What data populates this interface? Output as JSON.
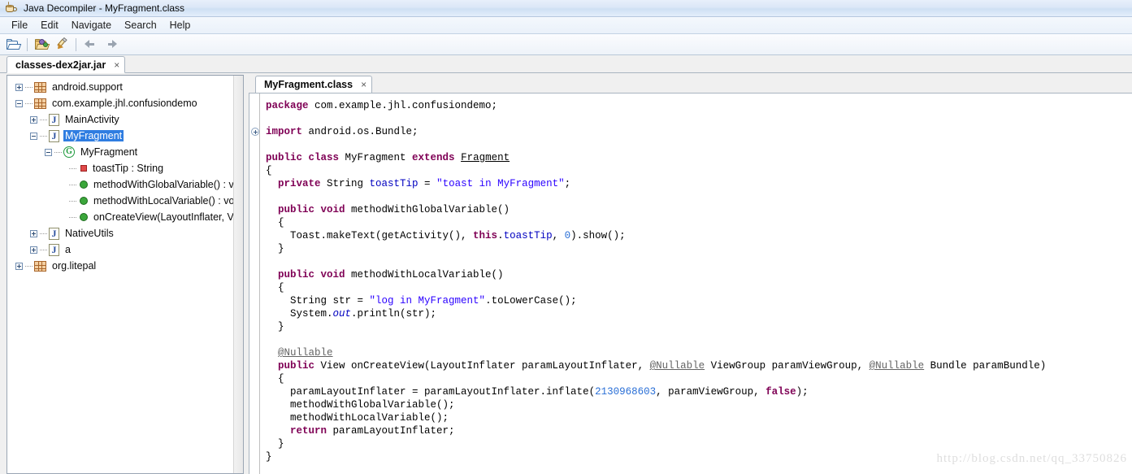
{
  "window": {
    "title": "Java Decompiler - MyFragment.class",
    "icon": "coffee-cup-icon"
  },
  "menubar": {
    "items": [
      {
        "label": "File"
      },
      {
        "label": "Edit"
      },
      {
        "label": "Navigate"
      },
      {
        "label": "Search"
      },
      {
        "label": "Help"
      }
    ]
  },
  "toolbar": {
    "buttons": [
      {
        "name": "open-file-button",
        "icon": "folder-open-icon"
      },
      {
        "name": "open-type-button",
        "icon": "folder-open-colored-icon"
      },
      {
        "name": "decompile-button",
        "icon": "pencil-icon"
      },
      {
        "name": "back-button",
        "icon": "arrow-left-icon"
      },
      {
        "name": "forward-button",
        "icon": "arrow-right-icon"
      }
    ]
  },
  "jar_tab": {
    "label": "classes-dex2jar.jar",
    "close": "×"
  },
  "tree": [
    {
      "depth": 0,
      "expander": "plus",
      "icon": "package-icon",
      "label": "android.support",
      "selected": false
    },
    {
      "depth": 0,
      "expander": "minus",
      "icon": "package-icon",
      "label": "com.example.jhl.confusiondemo",
      "selected": false
    },
    {
      "depth": 1,
      "expander": "plus",
      "icon": "class-file-icon",
      "label": "MainActivity",
      "selected": false
    },
    {
      "depth": 1,
      "expander": "minus",
      "icon": "class-file-icon",
      "label": "MyFragment",
      "selected": true
    },
    {
      "depth": 2,
      "expander": "minus",
      "icon": "class-green-icon",
      "label": "MyFragment",
      "selected": false
    },
    {
      "depth": 3,
      "expander": "none",
      "icon": "field-icon",
      "label": "toastTip : String",
      "selected": false
    },
    {
      "depth": 3,
      "expander": "none",
      "icon": "method-icon",
      "label": "methodWithGlobalVariable() : void",
      "selected": false
    },
    {
      "depth": 3,
      "expander": "none",
      "icon": "method-icon",
      "label": "methodWithLocalVariable() : void",
      "selected": false
    },
    {
      "depth": 3,
      "expander": "none",
      "icon": "method-icon",
      "label": "onCreateView(LayoutInflater, View",
      "selected": false
    },
    {
      "depth": 1,
      "expander": "plus",
      "icon": "class-file-icon",
      "label": "NativeUtils",
      "selected": false
    },
    {
      "depth": 1,
      "expander": "plus",
      "icon": "class-file-icon",
      "label": "a",
      "selected": false
    },
    {
      "depth": 0,
      "expander": "plus",
      "icon": "package-icon",
      "label": "org.litepal",
      "selected": false
    }
  ],
  "editor_tab": {
    "label": "MyFragment.class",
    "close": "×"
  },
  "code": {
    "lines": [
      [
        {
          "t": "package ",
          "c": "kw"
        },
        {
          "t": "com.example.jhl.confusiondemo;",
          "c": ""
        }
      ],
      [],
      [
        {
          "t": "import ",
          "c": "kw"
        },
        {
          "t": "android.os.Bundle;",
          "c": ""
        }
      ],
      [],
      [
        {
          "t": "public class ",
          "c": "kw"
        },
        {
          "t": "MyFragment ",
          "c": ""
        },
        {
          "t": "extends ",
          "c": "kw"
        },
        {
          "t": "Fragment",
          "c": "lnk"
        }
      ],
      [
        {
          "t": "{",
          "c": ""
        }
      ],
      [
        {
          "t": "  private ",
          "c": "kw"
        },
        {
          "t": "String ",
          "c": ""
        },
        {
          "t": "toastTip",
          "c": "fld"
        },
        {
          "t": " = ",
          "c": ""
        },
        {
          "t": "\"toast in MyFragment\"",
          "c": "str"
        },
        {
          "t": ";",
          "c": ""
        }
      ],
      [],
      [
        {
          "t": "  public void ",
          "c": "kw"
        },
        {
          "t": "methodWithGlobalVariable()",
          "c": ""
        }
      ],
      [
        {
          "t": "  {",
          "c": ""
        }
      ],
      [
        {
          "t": "    Toast.makeText(getActivity(), ",
          "c": ""
        },
        {
          "t": "this",
          "c": "kw"
        },
        {
          "t": ".",
          "c": ""
        },
        {
          "t": "toastTip",
          "c": "fld"
        },
        {
          "t": ", ",
          "c": ""
        },
        {
          "t": "0",
          "c": "num"
        },
        {
          "t": ").show();",
          "c": ""
        }
      ],
      [
        {
          "t": "  }",
          "c": ""
        }
      ],
      [],
      [
        {
          "t": "  public void ",
          "c": "kw"
        },
        {
          "t": "methodWithLocalVariable()",
          "c": ""
        }
      ],
      [
        {
          "t": "  {",
          "c": ""
        }
      ],
      [
        {
          "t": "    String str = ",
          "c": ""
        },
        {
          "t": "\"log in MyFragment\"",
          "c": "str"
        },
        {
          "t": ".toLowerCase();",
          "c": ""
        }
      ],
      [
        {
          "t": "    System.",
          "c": ""
        },
        {
          "t": "out",
          "c": "stat"
        },
        {
          "t": ".println(str);",
          "c": ""
        }
      ],
      [
        {
          "t": "  }",
          "c": ""
        }
      ],
      [],
      [
        {
          "t": "  ",
          "c": ""
        },
        {
          "t": "@Nullable",
          "c": "anno"
        }
      ],
      [
        {
          "t": "  public ",
          "c": "kw"
        },
        {
          "t": "View onCreateView(LayoutInflater paramLayoutInflater, ",
          "c": ""
        },
        {
          "t": "@Nullable",
          "c": "anno"
        },
        {
          "t": " ViewGroup paramViewGroup, ",
          "c": ""
        },
        {
          "t": "@Nullable",
          "c": "anno"
        },
        {
          "t": " Bundle paramBundle)",
          "c": ""
        }
      ],
      [
        {
          "t": "  {",
          "c": ""
        }
      ],
      [
        {
          "t": "    paramLayoutInflater = paramLayoutInflater.inflate(",
          "c": ""
        },
        {
          "t": "2130968603",
          "c": "num"
        },
        {
          "t": ", paramViewGroup, ",
          "c": ""
        },
        {
          "t": "false",
          "c": "kw"
        },
        {
          "t": ");",
          "c": ""
        }
      ],
      [
        {
          "t": "    methodWithGlobalVariable();",
          "c": ""
        }
      ],
      [
        {
          "t": "    methodWithLocalVariable();",
          "c": ""
        }
      ],
      [
        {
          "t": "    ",
          "c": ""
        },
        {
          "t": "return ",
          "c": "kw"
        },
        {
          "t": "paramLayoutInflater;",
          "c": ""
        }
      ],
      [
        {
          "t": "  }",
          "c": ""
        }
      ],
      [
        {
          "t": "}",
          "c": ""
        }
      ]
    ],
    "fold_marker_line": 2
  },
  "watermark": "http://blog.csdn.net/qq_33750826",
  "colors": {
    "selection": "#2f7de1",
    "keyword": "#7f0055",
    "string": "#2a00ff",
    "field": "#0000c0",
    "number": "#2a6fd6",
    "annotation": "#646464"
  }
}
